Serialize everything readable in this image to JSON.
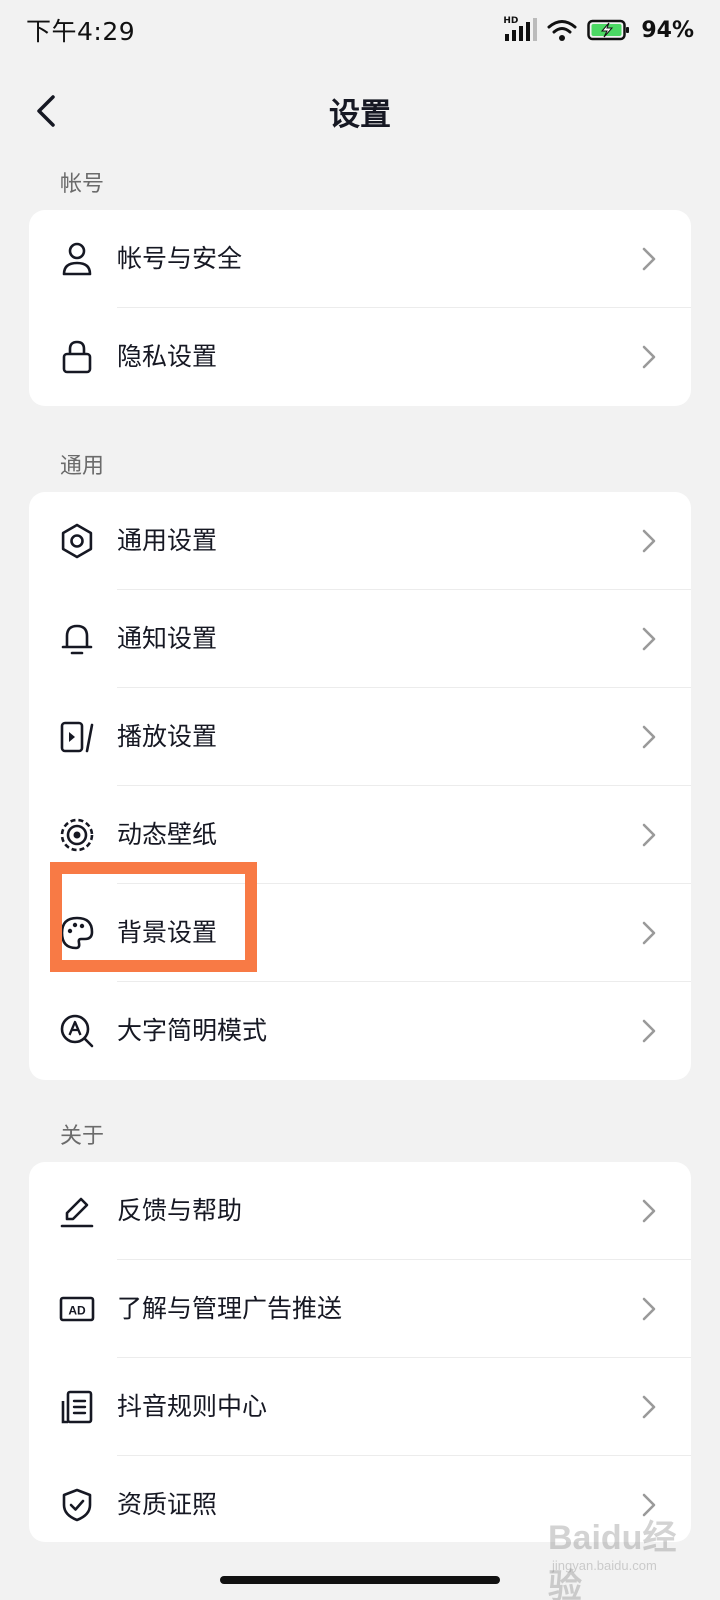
{
  "status_bar": {
    "time": "下午4:29",
    "network": "HD",
    "battery": "94%"
  },
  "nav": {
    "title": "设置"
  },
  "sections": {
    "account": {
      "title": "帐号",
      "items": [
        {
          "label": "帐号与安全",
          "icon": "user-icon"
        },
        {
          "label": "隐私设置",
          "icon": "lock-icon"
        }
      ]
    },
    "general": {
      "title": "通用",
      "items": [
        {
          "label": "通用设置",
          "icon": "gear-icon"
        },
        {
          "label": "通知设置",
          "icon": "bell-icon"
        },
        {
          "label": "播放设置",
          "icon": "play-icon"
        },
        {
          "label": "动态壁纸",
          "icon": "wallpaper-icon"
        },
        {
          "label": "背景设置",
          "icon": "palette-icon"
        },
        {
          "label": "大字简明模式",
          "icon": "large-font-icon"
        }
      ]
    },
    "about": {
      "title": "关于",
      "items": [
        {
          "label": "反馈与帮助",
          "icon": "edit-icon"
        },
        {
          "label": "了解与管理广告推送",
          "icon": "ad-icon"
        },
        {
          "label": "抖音规则中心",
          "icon": "document-icon"
        },
        {
          "label": "资质证照",
          "icon": "shield-check-icon"
        }
      ]
    }
  },
  "highlight_color": "#f87a45",
  "watermark": {
    "brand": "Baidu经验",
    "site": "jingyan.baidu.com"
  }
}
